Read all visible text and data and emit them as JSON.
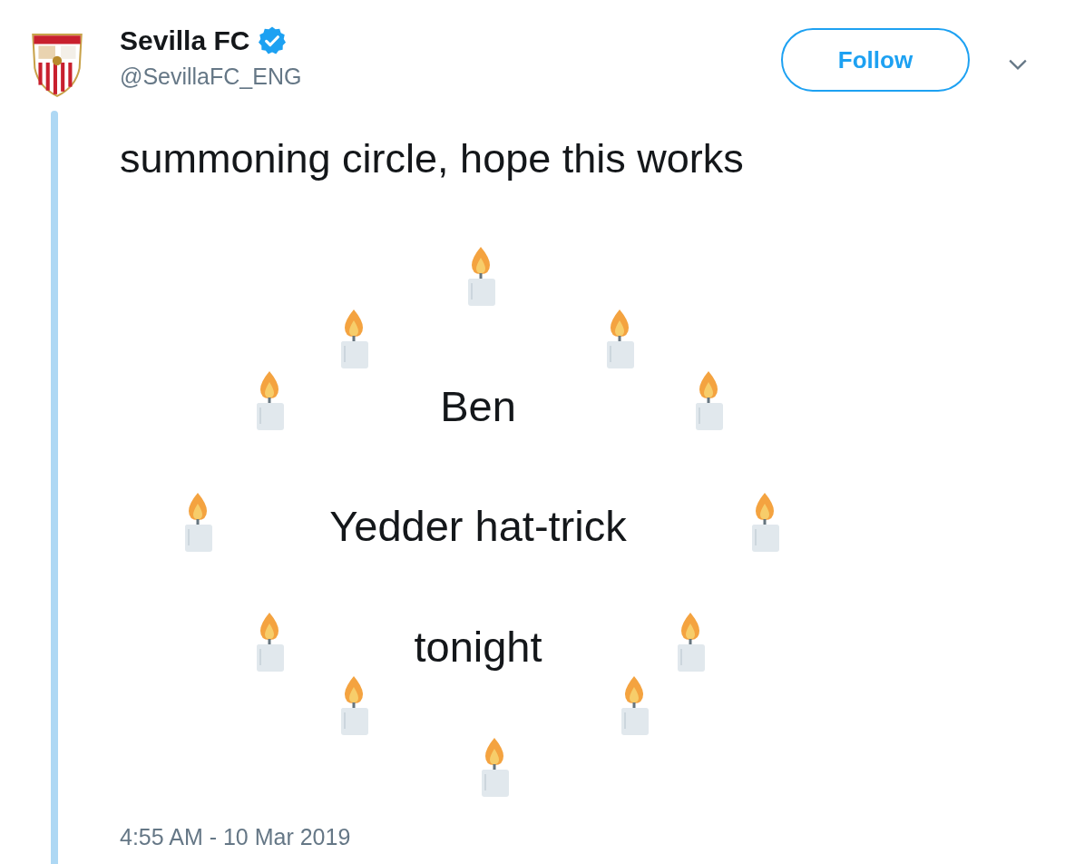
{
  "author": {
    "name": "Sevilla FC",
    "verified": true,
    "handle": "@SevillaFC_ENG"
  },
  "follow_button": {
    "label": "Follow"
  },
  "tweet": {
    "text": "summoning circle, hope this works",
    "circle_lines": [
      "Ben",
      "Yedder hat-trick",
      "tonight"
    ],
    "timestamp": "4:55 AM - 10 Mar 2019"
  }
}
